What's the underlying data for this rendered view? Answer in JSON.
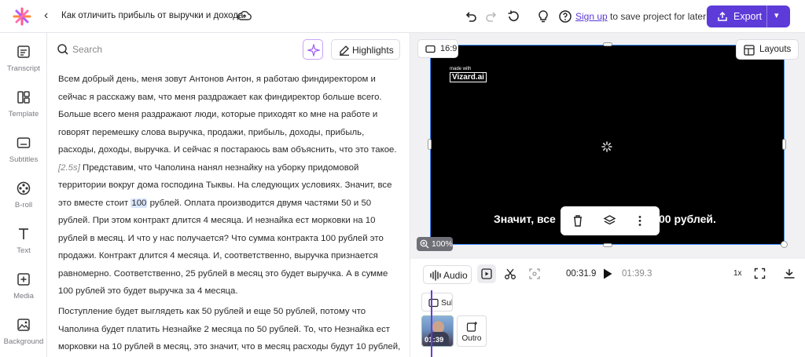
{
  "header": {
    "title": "Как отличить прибыль от выручки и дохода",
    "signup_link": "Sign up",
    "signup_text": " to save project for later",
    "export_label": "Export"
  },
  "sidebar": {
    "items": [
      {
        "label": "Transcript",
        "icon": "transcript-icon"
      },
      {
        "label": "Template",
        "icon": "template-icon"
      },
      {
        "label": "Subtitles",
        "icon": "subtitles-icon"
      },
      {
        "label": "B-roll",
        "icon": "film-reel-icon"
      },
      {
        "label": "Text",
        "icon": "text-icon"
      },
      {
        "label": "Media",
        "icon": "media-plus-icon"
      },
      {
        "label": "Background",
        "icon": "image-icon"
      }
    ]
  },
  "transcript": {
    "search_placeholder": "Search",
    "highlights_label": "Highlights",
    "p1_a": "Всем добрый день, меня зовут Антонов Антон, я работаю финдиректором и сейчас я расскажу вам, что меня раздражает как финдиректор больше всего. Больше всего меня раздражают люди, которые приходят ко мне на работе и говорят перемешку слова выручка, продажи, прибыль, доходы, прибыль, расходы, доходы, выручка. И сейчас я постараюсь вам объяснить, что это такое.",
    "timestamp": "[2.5s]",
    "p1_b": " Представим, что Чаполина нанял незнайку на уборку придомовой территории вокруг дома господина Тыквы. На следующих условиях. Значит, все это вместе стоит ",
    "highlight_word": "100",
    "p1_c": " рублей. Оплата производится двумя частями 50 и 50 рублей. При этом контракт длится 4 месяца. И незнайка ест морковки на 10 рублей в месяц. И что у нас получается? Что сумма контракта 100 рублей это продажи. Контракт длится 4 месяца. И, соответственно, выручка признается равномерно. Соответственно, 25 рублей в месяц это будет выручка. А в сумме 100 рублей это будет выручка за 4 месяца.",
    "p2": "Поступление будет выглядеть как 50 рублей и еще 50 рублей, потому что Чаполина будет платить Незнайке 2 месяца по 50 рублей. То, что Незнайка ест морковки на 10 рублей в месяц, это значит, что в месяц расходы будут 10 рублей,"
  },
  "preview": {
    "aspect_label": "16:9",
    "layouts_label": "Layouts",
    "watermark_small": "made with",
    "watermark_brand": "Vizard.ai",
    "caption_left": "Значит, все",
    "caption_right": "00 рублей.",
    "zoom_label": "100%"
  },
  "timeline": {
    "audio_label": "Audio",
    "current_time": "00:31.9",
    "total_time": "01:39.3",
    "speed": "1x",
    "subtitle_chip": "Sub",
    "clip_duration": "01:39",
    "outro_label": "Outro"
  },
  "colors": {
    "accent": "#5d3bd9",
    "selection": "#3b8cff",
    "highlight": "#dbe7ff"
  }
}
